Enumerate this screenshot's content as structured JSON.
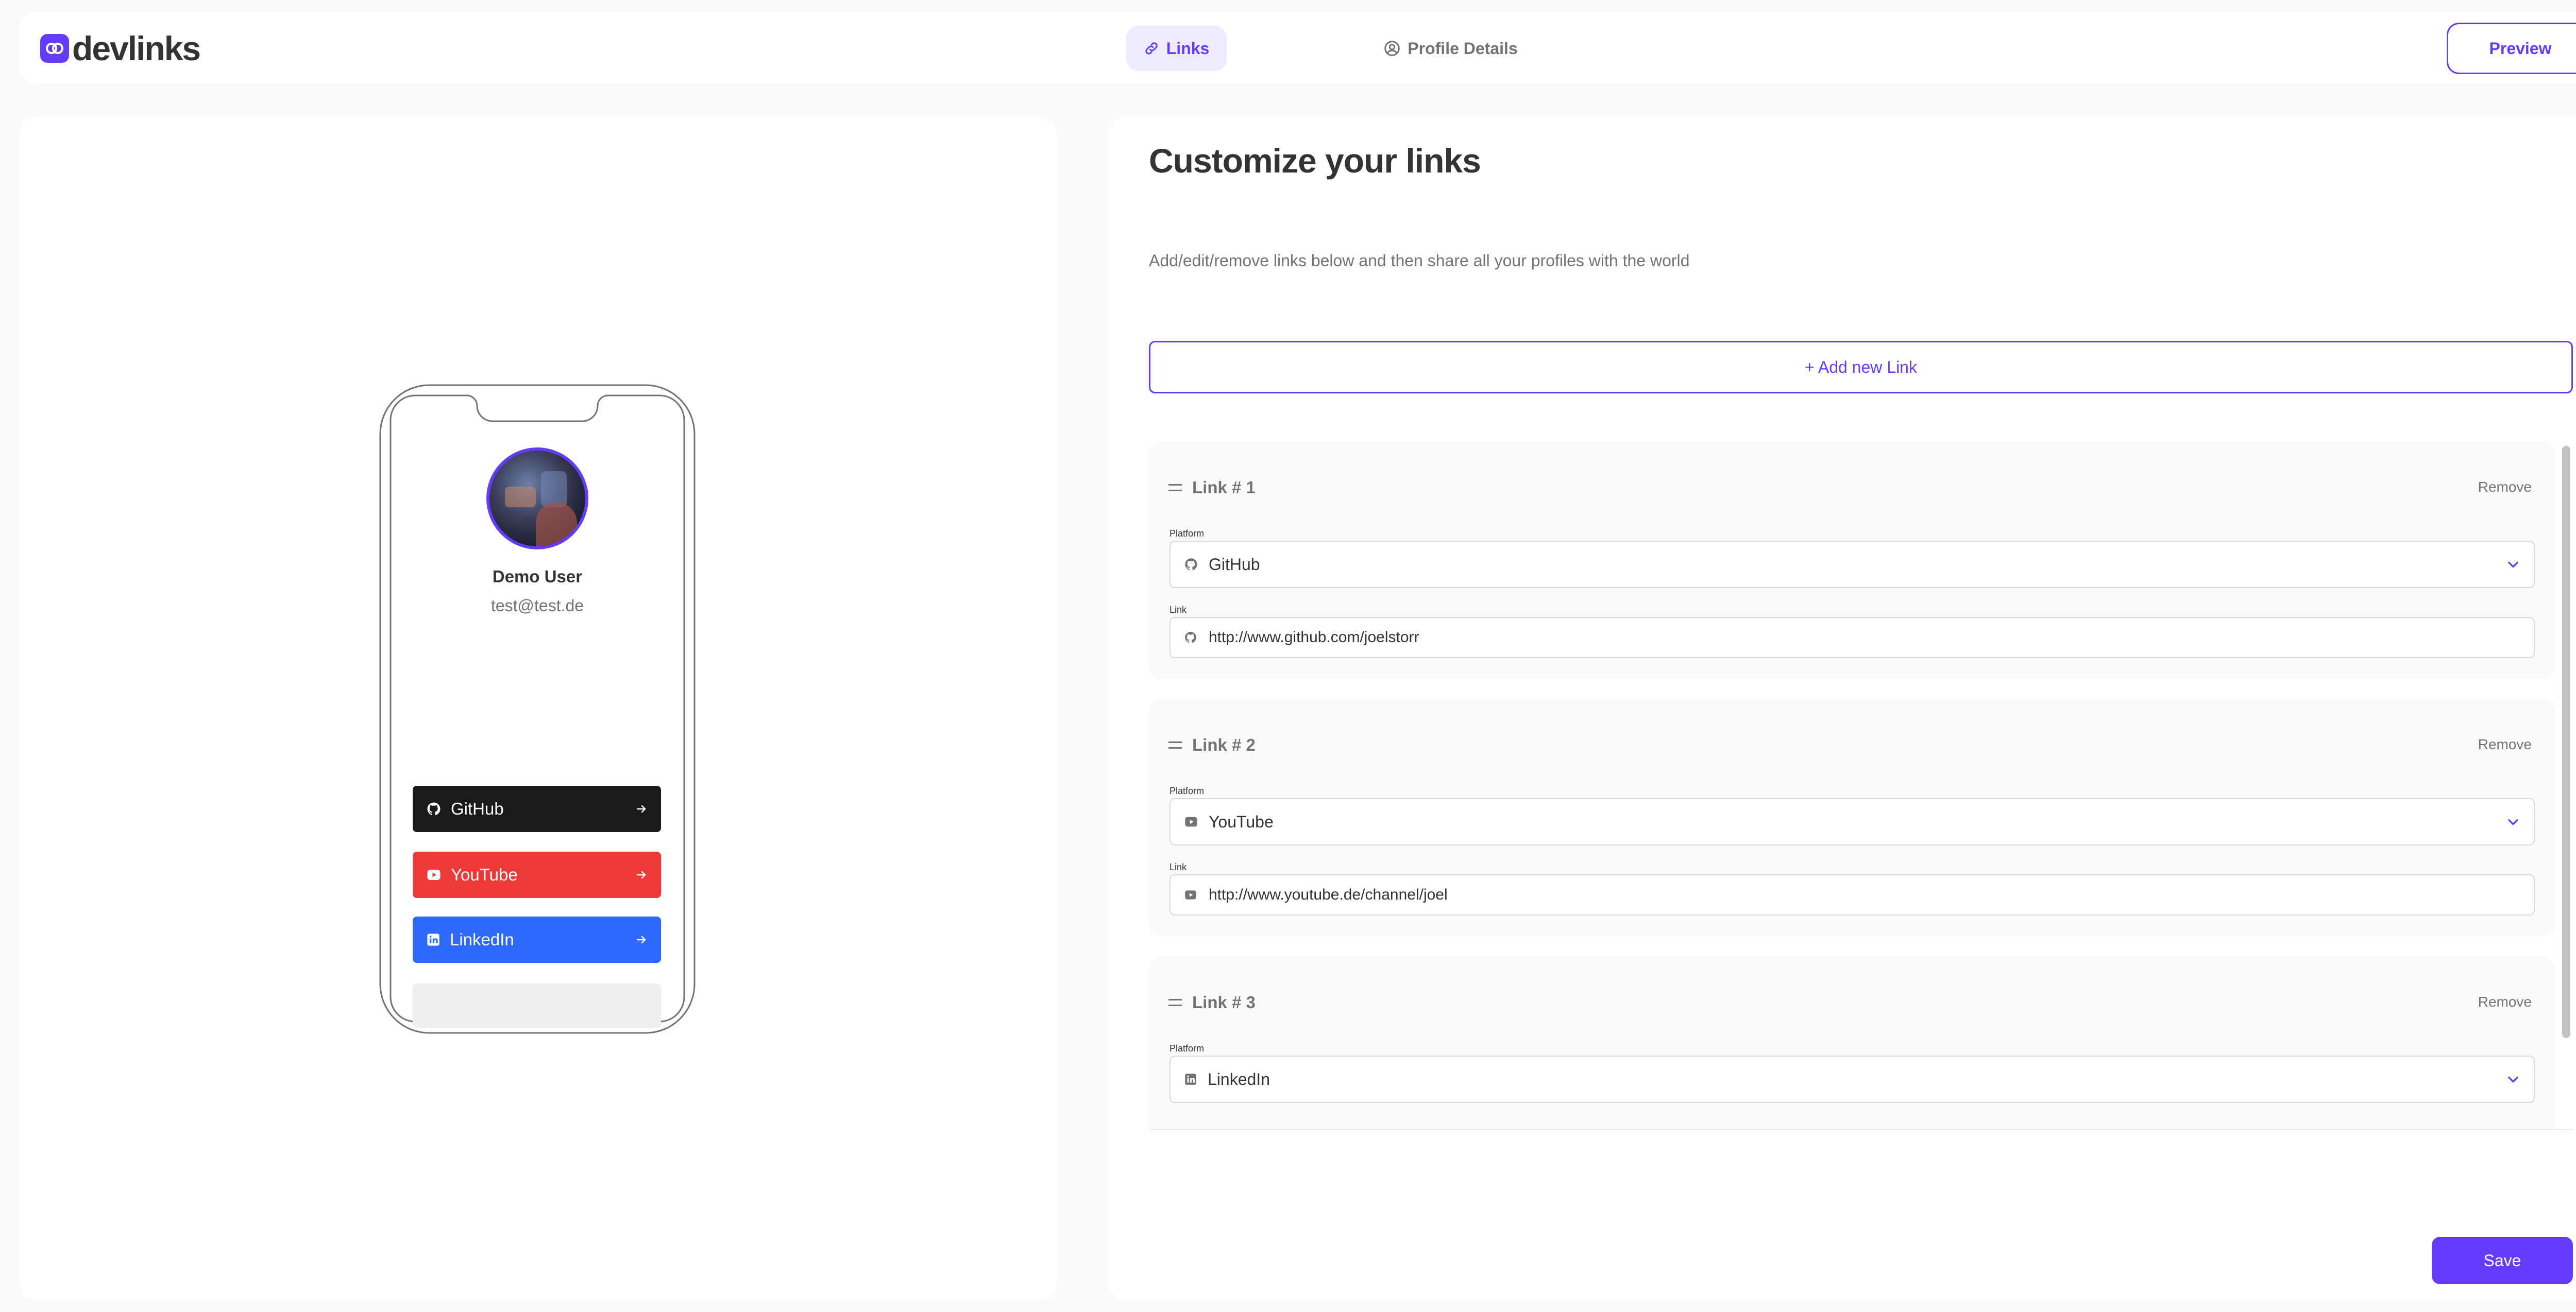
{
  "brand": {
    "name": "devlinks",
    "accent": "#633cff"
  },
  "nav": {
    "tabs": [
      {
        "label": "Links",
        "icon": "link-icon",
        "active": true
      },
      {
        "label": "Profile Details",
        "icon": "user-circle-icon",
        "active": false
      }
    ],
    "preview_label": "Preview"
  },
  "preview": {
    "name": "Demo User",
    "email": "test@test.de",
    "links": [
      {
        "label": "GitHub",
        "icon": "github-icon",
        "color": "#1a1a1a"
      },
      {
        "label": "YouTube",
        "icon": "youtube-icon",
        "color": "#ee3939"
      },
      {
        "label": "LinkedIn",
        "icon": "linkedin-icon",
        "color": "#2d68ff"
      }
    ]
  },
  "editor": {
    "title": "Customize your links",
    "subtitle": "Add/edit/remove links below and then share all your profiles with the world",
    "add_label": "+ Add new Link",
    "platform_label": "Platform",
    "link_label": "Link",
    "remove_label": "Remove",
    "links": [
      {
        "title": "Link # 1",
        "platform": "GitHub",
        "platform_icon": "github-icon",
        "url": "http://www.github.com/joelstorr"
      },
      {
        "title": "Link # 2",
        "platform": "YouTube",
        "platform_icon": "youtube-icon",
        "url": "http://www.youtube.de/channel/joel"
      },
      {
        "title": "Link # 3",
        "platform": "LinkedIn",
        "platform_icon": "linkedin-icon"
      }
    ],
    "save_label": "Save"
  }
}
